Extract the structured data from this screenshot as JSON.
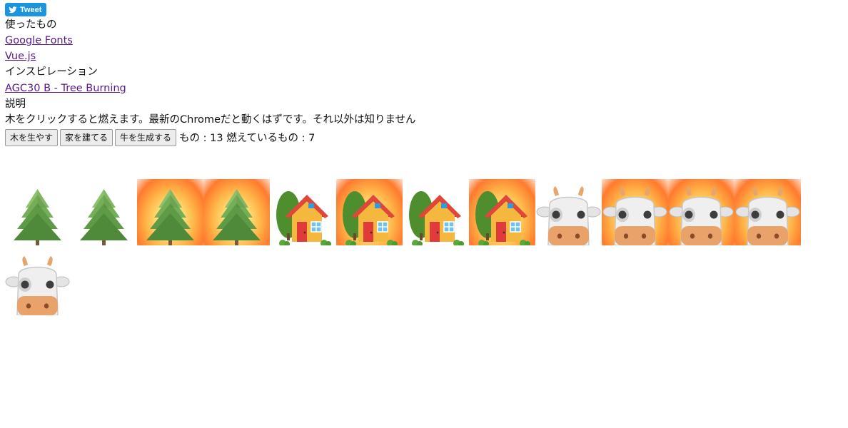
{
  "tweet": {
    "label": "Tweet",
    "icon": "twitter-bird-icon"
  },
  "used": {
    "heading": "使ったもの",
    "links": [
      "Google Fonts",
      "Vue.js"
    ]
  },
  "inspiration": {
    "heading": "インスピレーション",
    "link": "AGC30 B - Tree Burning"
  },
  "description": {
    "heading": "説明",
    "text": "木をクリックすると燃えます。最新のChromeだと動くはずです。それ以外は知りません"
  },
  "controls": {
    "buttons": [
      "木を生やす",
      "家を建てる",
      "牛を生成する"
    ],
    "status_text": "もの : 13 燃えているもの : 7",
    "total": 13,
    "burning": 7
  },
  "items": [
    {
      "kind": "tree",
      "burning": false
    },
    {
      "kind": "tree",
      "burning": false
    },
    {
      "kind": "tree",
      "burning": true
    },
    {
      "kind": "tree",
      "burning": true
    },
    {
      "kind": "house",
      "burning": false
    },
    {
      "kind": "house",
      "burning": true
    },
    {
      "kind": "house",
      "burning": false
    },
    {
      "kind": "house",
      "burning": true
    },
    {
      "kind": "cow",
      "burning": false
    },
    {
      "kind": "cow",
      "burning": true
    },
    {
      "kind": "cow",
      "burning": true
    },
    {
      "kind": "cow",
      "burning": true
    },
    {
      "kind": "cow",
      "burning": false
    }
  ],
  "colors": {
    "tweet_bg": "#1b95e0",
    "link": "#551a8b",
    "fire_core": "#ffe27a",
    "fire_edge": "#ff7a2e",
    "tree_green": "#5a9a46",
    "house_wall": "#f4b83e",
    "house_roof": "#d93a2c",
    "cow_muzzle": "#e9a26a"
  }
}
